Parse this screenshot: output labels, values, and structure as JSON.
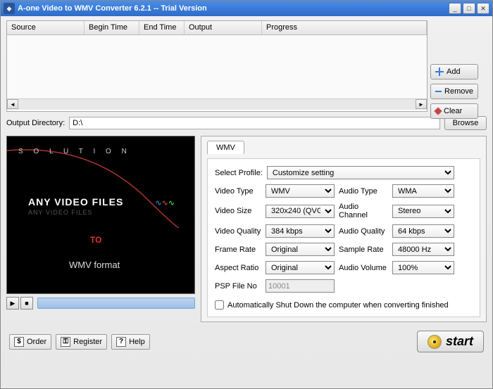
{
  "title": "A-one Video to WMV Converter 6.2.1 -- Trial Version",
  "table": {
    "cols": [
      "Source",
      "Begin Time",
      "End Time",
      "Output",
      "Progress"
    ]
  },
  "side": {
    "add": "Add",
    "remove": "Remove",
    "clear": "Clear"
  },
  "outdir": {
    "label": "Output Directory:",
    "value": "D:\\",
    "browse": "Browse"
  },
  "preview": {
    "solution": "S O L U T I O N",
    "anyline": "ANY VIDEO FILES",
    "anyline_ref": "ANY VIDEO FILES",
    "to": "TO",
    "fmt": "WMV format"
  },
  "settings": {
    "tab": "WMV",
    "profile_label": "Select Profile:",
    "profile": "Customize setting",
    "video_type_l": "Video Type",
    "video_type": "WMV",
    "audio_type_l": "Audio Type",
    "audio_type": "WMA",
    "video_size_l": "Video Size",
    "video_size": "320x240 (QVGA)",
    "audio_ch_l": "Audio Channel",
    "audio_ch": "Stereo",
    "video_q_l": "Video Quality",
    "video_q": "384 kbps",
    "audio_q_l": "Audio Quality",
    "audio_q": "64 kbps",
    "frame_l": "Frame Rate",
    "frame": "Original",
    "sample_l": "Sample Rate",
    "sample": "48000 Hz",
    "aspect_l": "Aspect Ratio",
    "aspect": "Original",
    "vol_l": "Audio Volume",
    "vol": "100%",
    "psp_l": "PSP File No",
    "psp": "10001",
    "shutdown": "Automatically Shut Down the computer when converting finished"
  },
  "bottom": {
    "order": "Order",
    "register": "Register",
    "help": "Help",
    "start": "start"
  }
}
